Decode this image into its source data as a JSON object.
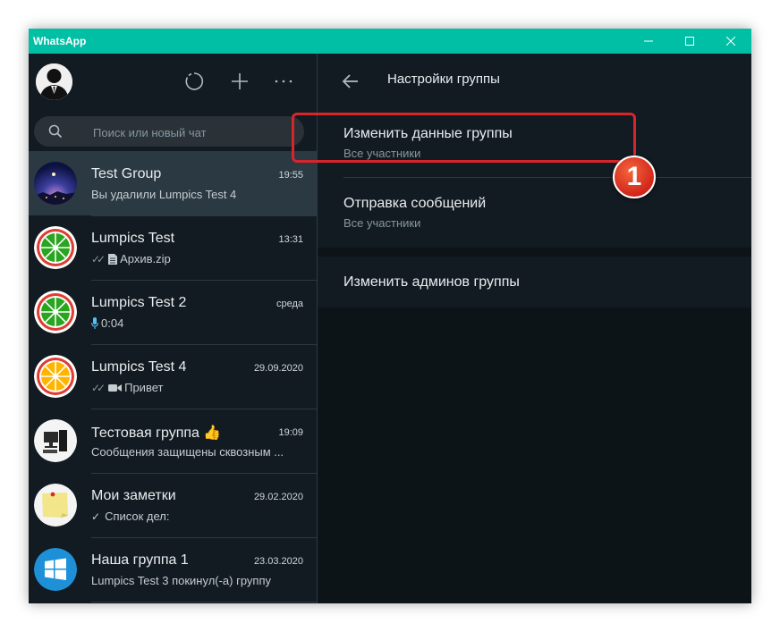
{
  "window": {
    "title": "WhatsApp"
  },
  "sidebar": {
    "search": {
      "placeholder": "Поиск или новый чат"
    },
    "chats": [
      {
        "name": "Test Group",
        "time": "19:55",
        "preview": "Вы удалили Lumpics Test 4",
        "avatar": "night-sky-avatar",
        "active": true
      },
      {
        "name": "Lumpics Test",
        "time": "13:31",
        "preview_prefix": "✓✓",
        "preview_icon": "document-icon",
        "preview": "Архив.zip",
        "avatar": "lime-slice-avatar"
      },
      {
        "name": "Lumpics Test 2",
        "time": "среда",
        "preview_icon": "microphone-icon",
        "preview": "0:04",
        "avatar": "lime-slice-avatar"
      },
      {
        "name": "Lumpics Test 4",
        "time": "29.09.2020",
        "preview_prefix": "✓✓",
        "preview_icon": "video-camera-icon",
        "preview": "Привет",
        "avatar": "orange-slice-avatar"
      },
      {
        "name": "Тестовая группа 👍",
        "time": "19:09",
        "preview": "Сообщения защищены сквозным ...",
        "avatar": "computer-avatar"
      },
      {
        "name": "Мои заметки",
        "time": "29.02.2020",
        "preview_prefix": "✓",
        "preview": "Список дел:",
        "avatar": "sticky-note-avatar"
      },
      {
        "name": "Наша группа 1",
        "time": "23.03.2020",
        "preview": "Lumpics Test 3 покинул(-а) группу",
        "avatar": "windows-logo-avatar"
      }
    ]
  },
  "main": {
    "title": "Настройки группы",
    "settings": [
      {
        "label": "Изменить данные группы",
        "sub": "Все участники"
      },
      {
        "label": "Отправка сообщений",
        "sub": "Все участники"
      },
      {
        "label": "Изменить админов группы"
      }
    ]
  },
  "annotation": {
    "badge": "1",
    "color": "#d7252c"
  },
  "colors": {
    "titlebar": "#00bfa5",
    "panel": "#121b22",
    "background": "#0d1418",
    "active_row": "#2a3942",
    "mic": "#4fc3f7"
  }
}
